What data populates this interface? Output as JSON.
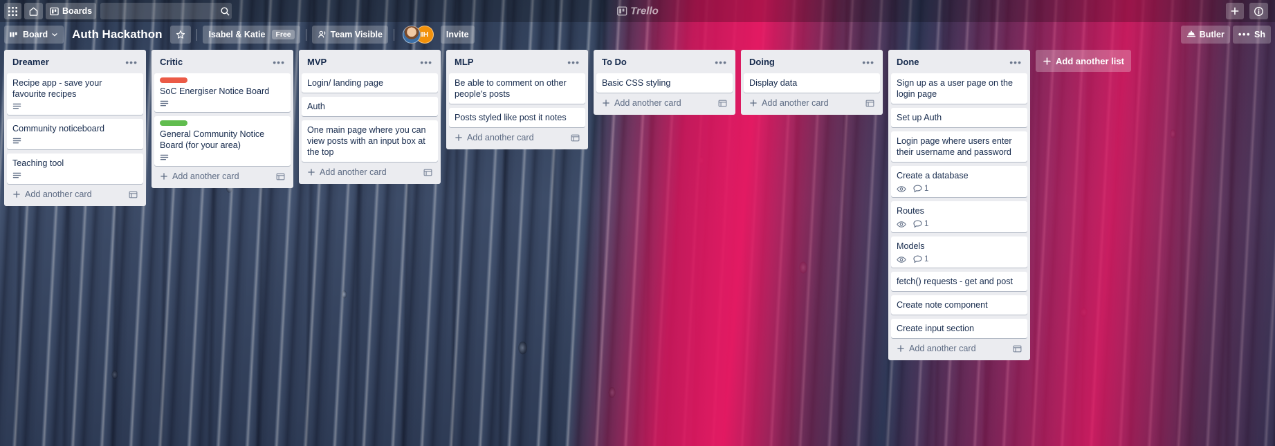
{
  "topbar": {
    "apps_icon": "grid-apps-icon",
    "home_icon": "home-icon",
    "boards_label": "Boards",
    "boards_icon": "board-icon",
    "search_placeholder": "",
    "search_value": "",
    "search_icon": "search-icon",
    "brand_name": "Trello",
    "add_icon": "plus-icon",
    "info_icon": "info-icon"
  },
  "boardbar": {
    "board_button_label": "Board",
    "board_button_icon": "board-view-icon",
    "board_chevron_icon": "chevron-down-icon",
    "title": "Auth Hackathon",
    "star_icon": "star-icon",
    "team_name": "Isabel & Katie",
    "plan_badge": "Free",
    "visibility_label": "Team Visible",
    "visibility_icon": "team-visible-icon",
    "members": [
      {
        "name": "avatar-photo",
        "initials": ""
      },
      {
        "name": "avatar-initials",
        "initials": "IH"
      }
    ],
    "invite_label": "Invite",
    "butler_label": "Butler",
    "butler_icon": "butler-bell-icon",
    "menu_dots_icon": "ellipsis-icon",
    "show_menu_label": "Sh"
  },
  "board": {
    "add_list_label": "Add another list",
    "add_list_icon": "plus-icon",
    "add_card_label": "Add another card",
    "add_card_icon": "plus-icon",
    "card_template_icon": "template-card-icon",
    "list_menu_icon": "ellipsis-icon",
    "description_badge_icon": "description-icon",
    "watch_badge_icon": "eye-icon",
    "comment_badge_icon": "comment-icon",
    "colors": {
      "label_red": "#eb5a46",
      "label_green": "#61bd4f",
      "list_background": "#ebecf0",
      "card_background": "#ffffff",
      "text_primary": "#172b4d",
      "text_muted": "#5e6c84"
    },
    "lists": [
      {
        "title": "Dreamer",
        "cards": [
          {
            "title": "Recipe app - save your favourite recipes",
            "labels": [],
            "has_description": true,
            "watching": false,
            "comments": null
          },
          {
            "title": "Community noticeboard",
            "labels": [],
            "has_description": true,
            "watching": false,
            "comments": null
          },
          {
            "title": "Teaching tool",
            "labels": [],
            "has_description": true,
            "watching": false,
            "comments": null
          }
        ]
      },
      {
        "title": "Critic",
        "cards": [
          {
            "title": "SoC Energiser Notice Board",
            "labels": [
              "#eb5a46"
            ],
            "has_description": true,
            "watching": false,
            "comments": null
          },
          {
            "title": "General Community Notice Board (for your area)",
            "labels": [
              "#61bd4f"
            ],
            "has_description": true,
            "watching": false,
            "comments": null
          }
        ]
      },
      {
        "title": "MVP",
        "cards": [
          {
            "title": "Login/ landing page",
            "labels": [],
            "has_description": false,
            "watching": false,
            "comments": null
          },
          {
            "title": "Auth",
            "labels": [],
            "has_description": false,
            "watching": false,
            "comments": null
          },
          {
            "title": "One main page where you can view posts with an input box at the top",
            "labels": [],
            "has_description": false,
            "watching": false,
            "comments": null
          }
        ]
      },
      {
        "title": "MLP",
        "cards": [
          {
            "title": "Be able to comment on other people's posts",
            "labels": [],
            "has_description": false,
            "watching": false,
            "comments": null
          },
          {
            "title": "Posts styled like post it notes",
            "labels": [],
            "has_description": false,
            "watching": false,
            "comments": null
          }
        ]
      },
      {
        "title": "To Do",
        "cards": [
          {
            "title": "Basic CSS styling",
            "labels": [],
            "has_description": false,
            "watching": false,
            "comments": null
          }
        ]
      },
      {
        "title": "Doing",
        "cards": [
          {
            "title": "Display data",
            "labels": [],
            "has_description": false,
            "watching": false,
            "comments": null
          }
        ]
      },
      {
        "title": "Done",
        "cards": [
          {
            "title": "Sign up as a user page on the login page",
            "labels": [],
            "has_description": false,
            "watching": false,
            "comments": null
          },
          {
            "title": "Set up Auth",
            "labels": [],
            "has_description": false,
            "watching": false,
            "comments": null
          },
          {
            "title": "Login page where users enter their username and password",
            "labels": [],
            "has_description": false,
            "watching": false,
            "comments": null
          },
          {
            "title": "Create a database",
            "labels": [],
            "has_description": false,
            "watching": true,
            "comments": "1"
          },
          {
            "title": "Routes",
            "labels": [],
            "has_description": false,
            "watching": true,
            "comments": "1"
          },
          {
            "title": "Models",
            "labels": [],
            "has_description": false,
            "watching": true,
            "comments": "1"
          },
          {
            "title": "fetch() requests - get and post",
            "labels": [],
            "has_description": false,
            "watching": false,
            "comments": null
          },
          {
            "title": "Create note component",
            "labels": [],
            "has_description": false,
            "watching": false,
            "comments": null
          },
          {
            "title": "Create input section",
            "labels": [],
            "has_description": false,
            "watching": false,
            "comments": null
          }
        ]
      }
    ]
  }
}
